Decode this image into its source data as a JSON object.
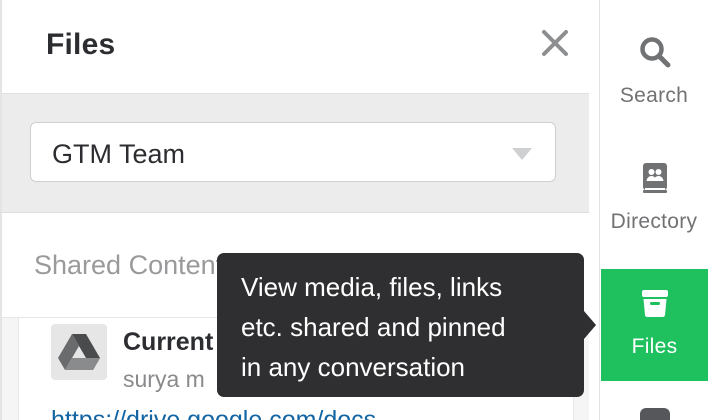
{
  "panel": {
    "title": "Files",
    "close_icon": "close-icon",
    "channel_select": {
      "value": "GTM Team",
      "caret_icon": "chevron-down-icon"
    },
    "section": {
      "label": "Shared Content"
    },
    "files": [
      {
        "name": "Current",
        "meta": "surya m",
        "link": "https://drive.google.com/docs",
        "icon": "google-drive-icon"
      }
    ]
  },
  "rail": {
    "items": [
      {
        "label": "Search",
        "icon": "search-icon"
      },
      {
        "label": "Directory",
        "icon": "directory-icon"
      },
      {
        "label": "Files",
        "icon": "files-icon",
        "active": true
      }
    ]
  },
  "tooltip": {
    "line1": "View media, files, links",
    "line2": "etc. shared and pinned",
    "line3": "in any conversation"
  },
  "colors": {
    "accent": "#1fc15f",
    "tooltip_bg": "#2f2f31",
    "link": "#1264a3"
  }
}
